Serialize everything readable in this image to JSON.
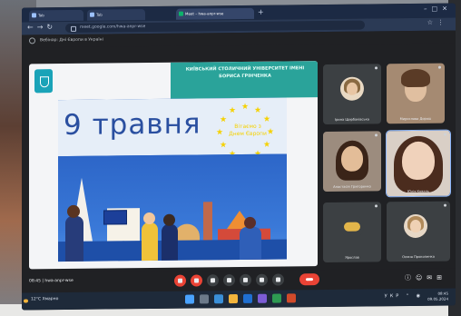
{
  "browser": {
    "tabs": [
      {
        "label": "Tab"
      },
      {
        "label": "Tab"
      },
      {
        "label": "Meet – hwa-anpr-wse",
        "active": true
      }
    ],
    "new_tab_icon": "plus-icon",
    "url": "meet.google.com/hwa-anpr-wse"
  },
  "meeting": {
    "title": "Вебінар: Дні Європи в Україні",
    "presentation": {
      "university_heading": "КИЇВСЬКИЙ СТОЛИЧНИЙ УНІВЕРСИТЕТ ІМЕНІ БОРИСА ГРІНЧЕНКА",
      "date_title": "9 травня",
      "eu_caption": "Вітаємо з Днем Європи"
    },
    "participants": [
      {
        "name": "Ірина Щербаківська",
        "avatar_color": "#c9a27a"
      },
      {
        "name": "Мирослава Дорош",
        "avatar_color": "#b88465"
      },
      {
        "name": "Анастасія Григоренко",
        "avatar_color": "#caa078"
      },
      {
        "name": "Юлія Коваль",
        "avatar_color": "#d9b49a"
      },
      {
        "name": "Ярослав",
        "avatar_color": "#e2b54a"
      },
      {
        "name": "Олена Прокопенко",
        "avatar_color": "#d4b08a"
      }
    ],
    "meeting_code": "hwa-anpr-wse",
    "time": "08:45"
  },
  "taskbar": {
    "weather_temp": "12°C",
    "weather_desc": "Хмарно",
    "clock_time": "08:45",
    "clock_date": "09.05.2024",
    "lang": "УКР"
  },
  "colors": {
    "accent_green": "#2aa39a",
    "end_call_red": "#ea4335",
    "eu_blue": "#2a64c4",
    "eu_yellow": "#f5d100"
  }
}
